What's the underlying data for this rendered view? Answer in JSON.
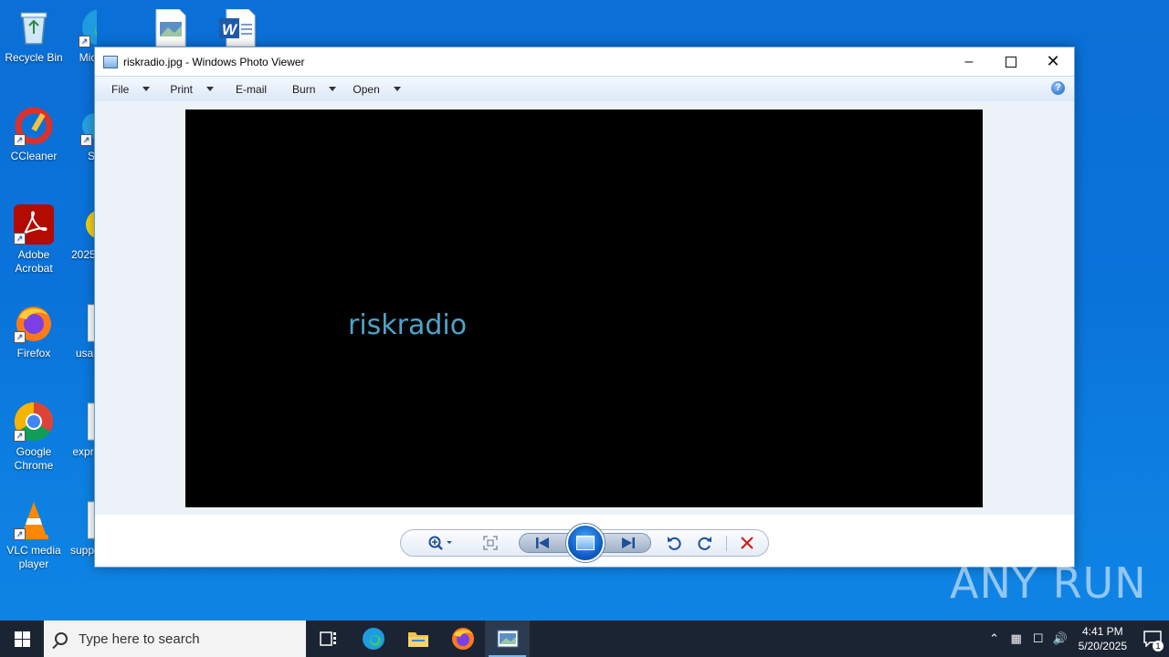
{
  "desktop": {
    "icons": [
      {
        "label": "Recycle Bin",
        "icon": "recycle-bin-icon"
      },
      {
        "label": "CCleaner",
        "icon": "ccleaner-icon"
      },
      {
        "label": "Adobe Acrobat",
        "icon": "adobe-acrobat-icon"
      },
      {
        "label": "Firefox",
        "icon": "firefox-icon"
      },
      {
        "label": "Google Chrome",
        "icon": "chrome-icon"
      },
      {
        "label": "VLC media player",
        "icon": "vlc-icon"
      }
    ],
    "partial_icons": [
      {
        "label": "Mic",
        "icon": "edge-icon"
      },
      {
        "label": "S",
        "icon": "app-icon"
      },
      {
        "label": "2025",
        "icon": "emoji-icon"
      },
      {
        "label": "usa",
        "icon": "file-icon"
      },
      {
        "label": "expr",
        "icon": "file-icon"
      },
      {
        "label": "supp",
        "icon": "file-icon"
      }
    ]
  },
  "window": {
    "title": "riskradio.jpg - Windows Photo Viewer",
    "menu": [
      "File",
      "Print",
      "E-mail",
      "Burn",
      "Open"
    ],
    "photo_text": "riskradio",
    "controls": [
      "zoom-icon",
      "fit-window-icon",
      "previous-icon",
      "slideshow-icon",
      "next-icon",
      "rotate-ccw-icon",
      "rotate-cw-icon",
      "delete-icon"
    ]
  },
  "watermark": "ANY RUN",
  "taskbar": {
    "search_placeholder": "Type here to search",
    "time": "4:41 PM",
    "date": "5/20/2025",
    "notification_count": "1"
  },
  "colors": {
    "desktop_blue": "#0a73da",
    "taskbar": "#1b2433",
    "photo_text": "#4fa3c9"
  }
}
